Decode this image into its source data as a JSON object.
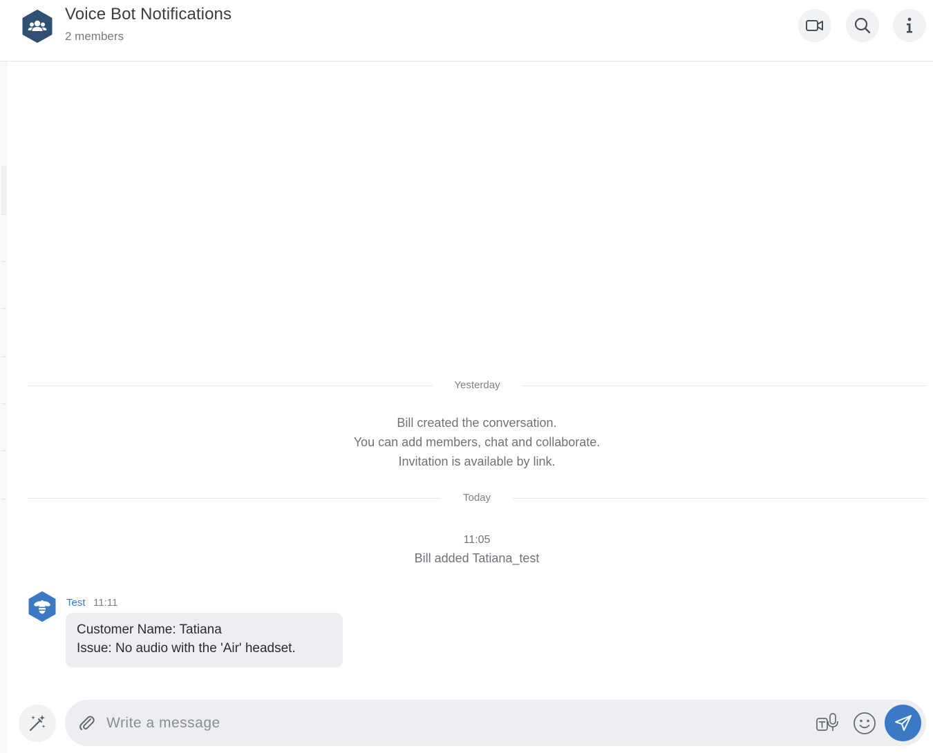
{
  "header": {
    "title": "Voice Bot Notifications",
    "subtitle": "2 members",
    "avatar_icon": "group-icon",
    "actions": [
      {
        "name": "video-call-button",
        "icon": "video-camera-icon"
      },
      {
        "name": "search-button",
        "icon": "search-icon"
      },
      {
        "name": "info-button",
        "icon": "info-icon"
      }
    ]
  },
  "timeline": {
    "yesterday_label": "Yesterday",
    "system_messages": [
      "Bill created the conversation.",
      "You can add members, chat and collaborate.",
      "Invitation is available by link."
    ],
    "today_label": "Today",
    "event_time": "11:05",
    "event_text": "Bill added Tatiana_test"
  },
  "message": {
    "author": "Test",
    "time": "11:11",
    "avatar_icon": "bee-icon",
    "lines": [
      "Customer Name: Tatiana",
      "Issue: No audio with the 'Air' headset."
    ]
  },
  "composer": {
    "placeholder": "Write a message",
    "value": "",
    "icons": [
      "magic-wand-icon",
      "paperclip-icon",
      "speech-to-text-icon",
      "emoji-icon",
      "send-icon"
    ]
  },
  "colors": {
    "accent": "#3b78c6",
    "avatar_dark": "#2f4f73",
    "bubble_bg": "#eceef1",
    "button_bg": "#f1f2f4"
  }
}
